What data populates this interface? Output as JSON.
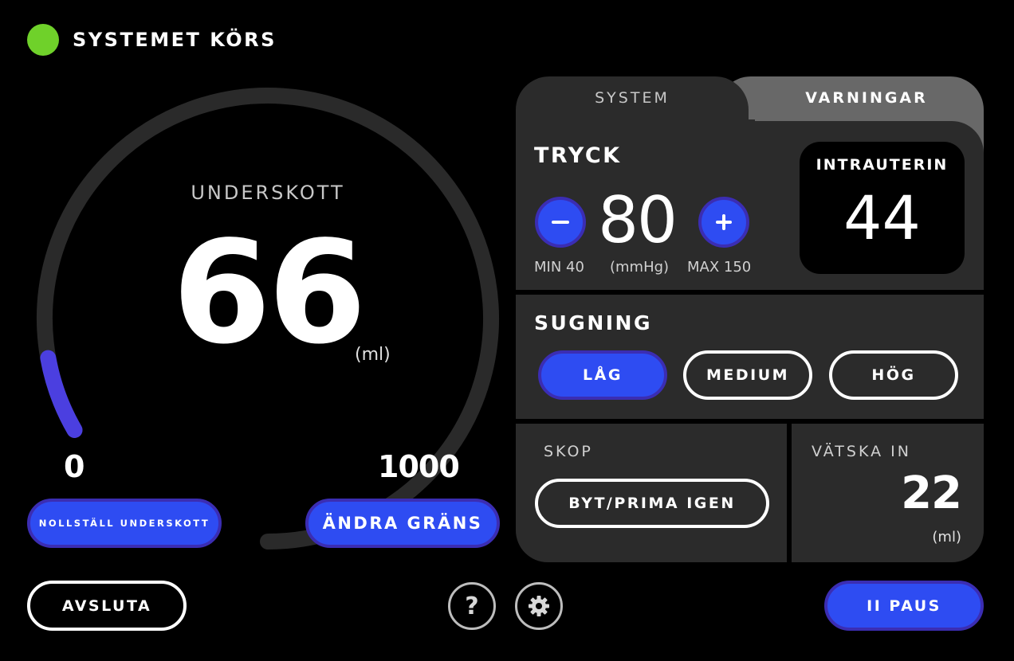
{
  "status": {
    "text": "SYSTEMET KÖRS",
    "color": "#6fd12a"
  },
  "gauge": {
    "label": "UNDERSKOTT",
    "value": "66",
    "value_num": 66,
    "unit": "(ml)",
    "min_label": "0",
    "max_label": "1000",
    "min": 0,
    "max": 1000,
    "fill_color": "#4b3fe0",
    "track_color": "#2a2a2a"
  },
  "buttons": {
    "reset": "NOLLSTÄLL UNDERSKOTT",
    "change_limit": "ÄNDRA GRÄNS",
    "exit": "AVSLUTA",
    "pause": "II PAUS",
    "help": "?"
  },
  "tabs": [
    {
      "label": "SYSTEM",
      "active": true
    },
    {
      "label": "VARNINGAR",
      "active": false
    }
  ],
  "pressure": {
    "title": "TRYCK",
    "value": "80",
    "min_label": "MIN 40",
    "unit": "(mmHg)",
    "max_label": "MAX 150"
  },
  "intrauterine": {
    "label": "INTRAUTERIN",
    "value": "44"
  },
  "suction": {
    "title": "SUGNING",
    "options": [
      {
        "label": "LÅG",
        "selected": true
      },
      {
        "label": "MEDIUM",
        "selected": false
      },
      {
        "label": "HÖG",
        "selected": false
      }
    ]
  },
  "scope": {
    "title": "SKOP",
    "button": "BYT/PRIMA IGEN"
  },
  "fluid_in": {
    "title": "VÄTSKA IN",
    "value": "22",
    "unit": "(ml)"
  },
  "colors": {
    "accent": "#2e4cf2",
    "accent_border": "#3b2db3",
    "panel": "#2b2b2b",
    "background": "#000000"
  }
}
